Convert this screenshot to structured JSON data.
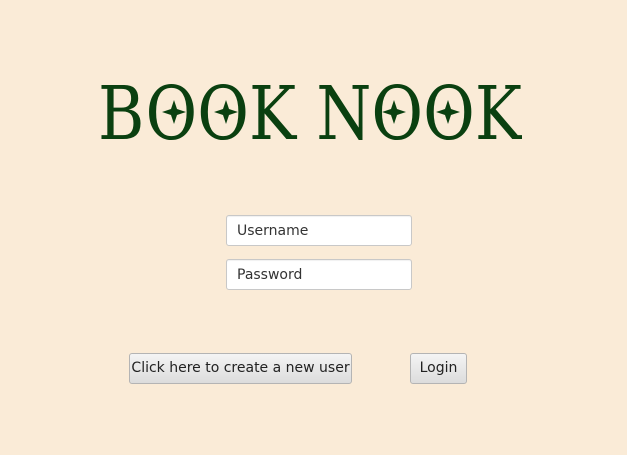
{
  "app": {
    "logo_text": "BOOK NOOK"
  },
  "login_form": {
    "username_placeholder": "Username",
    "password_placeholder": "Password",
    "create_user_label": "Click here to create a new user",
    "login_label": "Login"
  },
  "colors": {
    "background": "#faebd7",
    "logo": "#0a4010"
  },
  "icons": {
    "logo_ornaments": "four-point-star"
  }
}
